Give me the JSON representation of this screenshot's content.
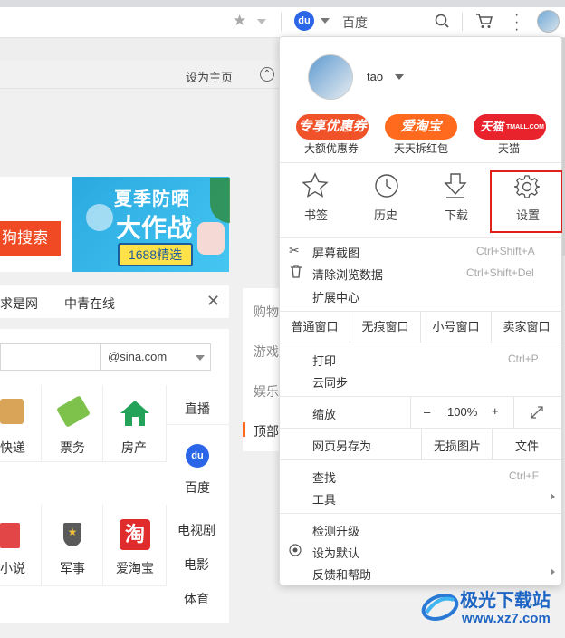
{
  "toolbar": {
    "search_engine_name": "百度"
  },
  "bookmark_bar": {
    "set_home_label": "设为主页"
  },
  "page": {
    "banner": {
      "title_line1": "夏季防晒",
      "title_line2": "大作战",
      "tag": "1688精选",
      "search_button": "狗搜索"
    },
    "links_row": {
      "link1": "求是网",
      "link2": "中青在线"
    },
    "email": {
      "suffix": "@sina.com"
    },
    "grid": {
      "row1": [
        {
          "label": "快递",
          "icon": "box-icon"
        },
        {
          "label": "票务",
          "icon": "ticket-icon"
        },
        {
          "label": "房产",
          "icon": "house-icon"
        }
      ],
      "row2": [
        {
          "label": "小说",
          "icon": "book-icon"
        },
        {
          "label": "军事",
          "icon": "military-badge-icon"
        },
        {
          "label": "爱淘宝",
          "icon": "taobao-icon"
        }
      ],
      "side_top": [
        "直播",
        "百度"
      ],
      "side_bottom": [
        "电视剧",
        "电影",
        "体育"
      ]
    },
    "right_column": [
      "购物",
      "游戏",
      "娱乐",
      "顶部"
    ]
  },
  "menu": {
    "profile": {
      "username": "tao"
    },
    "promos": [
      {
        "pill": "专享优惠券",
        "label": "大额优惠券",
        "color": "#f0532a"
      },
      {
        "pill": "爱淘宝",
        "label": "天天拆红包",
        "color": "#ff6a1f"
      },
      {
        "pill": "天猫",
        "pill_small": "TMALL.COM",
        "label": "天猫",
        "color": "#e8232b"
      }
    ],
    "quick": [
      {
        "label": "书签",
        "icon": "star-icon"
      },
      {
        "label": "历史",
        "icon": "clock-icon"
      },
      {
        "label": "下载",
        "icon": "download-icon"
      },
      {
        "label": "设置",
        "icon": "gear-icon"
      }
    ],
    "group1": [
      {
        "label": "屏幕截图",
        "shortcut": "Ctrl+Shift+A",
        "icon": "scissors-icon"
      },
      {
        "label": "清除浏览数据",
        "shortcut": "Ctrl+Shift+Del",
        "icon": "trash-icon"
      },
      {
        "label": "扩展中心",
        "shortcut": ""
      }
    ],
    "windows": [
      "普通窗口",
      "无痕窗口",
      "小号窗口",
      "卖家窗口"
    ],
    "group2": [
      {
        "label": "打印",
        "shortcut": "Ctrl+P"
      },
      {
        "label": "云同步",
        "shortcut": ""
      }
    ],
    "zoom": {
      "label": "缩放",
      "minus": "–",
      "value": "100%",
      "plus": "+"
    },
    "save_row": {
      "label": "网页另存为",
      "no_image": "无损图片",
      "file": "文件"
    },
    "group3": [
      {
        "label": "查找",
        "shortcut": "Ctrl+F"
      },
      {
        "label": "工具",
        "shortcut": ""
      }
    ],
    "group4": [
      {
        "label": "检测升级"
      },
      {
        "label": "设为默认",
        "icon": "radio-target-icon"
      },
      {
        "label": "反馈和帮助"
      }
    ]
  },
  "watermark": {
    "name": "极光下载站",
    "url": "www.xz7.com"
  }
}
